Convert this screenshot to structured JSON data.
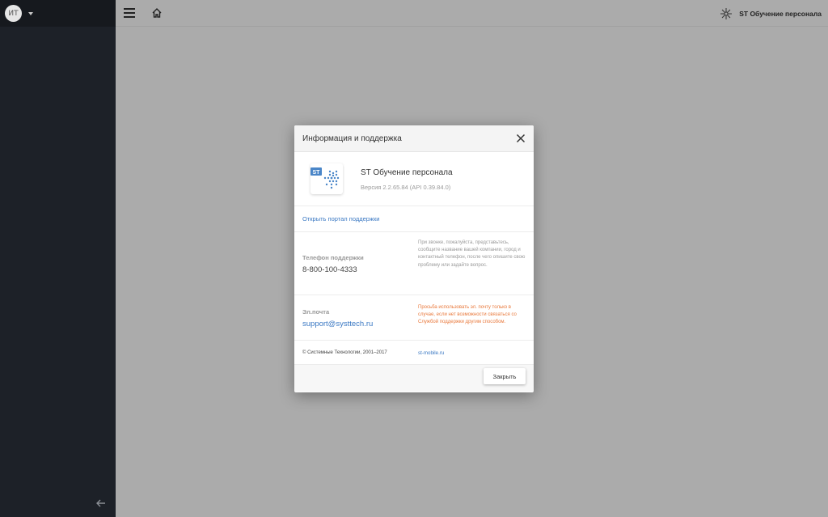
{
  "user": {
    "initials": "ИТ"
  },
  "header": {
    "app_title": "ST Обучение персонала"
  },
  "modal": {
    "title": "Информация и поддержка",
    "app": {
      "logo_text": "ST",
      "name": "ST Обучение персонала",
      "version": "Версия 2.2.65.84 (API 0.39.84.0)"
    },
    "support_portal_link": "Открыть портал поддержки",
    "phone": {
      "label": "Телефон поддержки",
      "value": "8-800-100-4333",
      "note": "При звонке, пожалуйста, представьтесь, сообщите название вашей компании, город и контактный телефон, после чего опишите свою проблему или задайте вопрос."
    },
    "email": {
      "label": "Эл.почта",
      "value": "support@systtech.ru",
      "note": "Просьба использовать эл. почту только в случае, если нет возможности связаться со Службой поддержки другим способом."
    },
    "copyright": "© Системные Технологии, 2001–2017",
    "site_link": "st-mobile.ru",
    "close_button": "Закрыть"
  },
  "colors": {
    "sidebar_bg": "#1d2128",
    "overlay_bg": "#ababab",
    "link": "#3a78c3",
    "warning": "#e9793c",
    "logo_blue": "#4a86c8"
  },
  "icons": [
    "chevron-down-icon",
    "menu-icon",
    "home-icon",
    "app-logo-icon",
    "close-icon",
    "arrow-left-icon"
  ]
}
